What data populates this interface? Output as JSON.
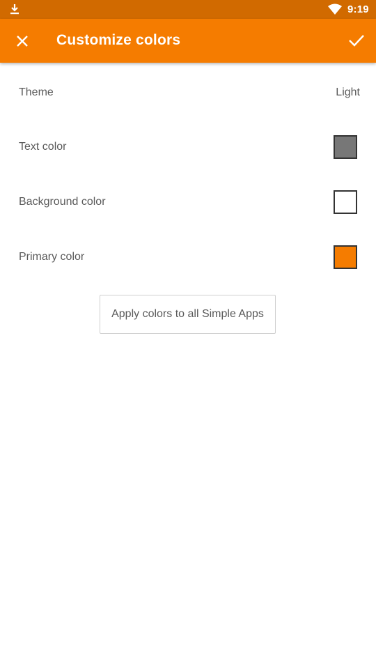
{
  "status_bar": {
    "time": "9:19",
    "icons": [
      "download-icon",
      "wifi-icon"
    ]
  },
  "app_bar": {
    "title": "Customize colors",
    "close_icon": "close-icon",
    "confirm_icon": "check-icon",
    "background": "#f57c00"
  },
  "settings": {
    "theme": {
      "label": "Theme",
      "value": "Light"
    },
    "text_color": {
      "label": "Text color",
      "color": "#777777"
    },
    "background_color": {
      "label": "Background color",
      "color": "#ffffff"
    },
    "primary_color": {
      "label": "Primary color",
      "color": "#f57c00"
    }
  },
  "apply_button": {
    "label": "Apply colors to all Simple Apps"
  }
}
